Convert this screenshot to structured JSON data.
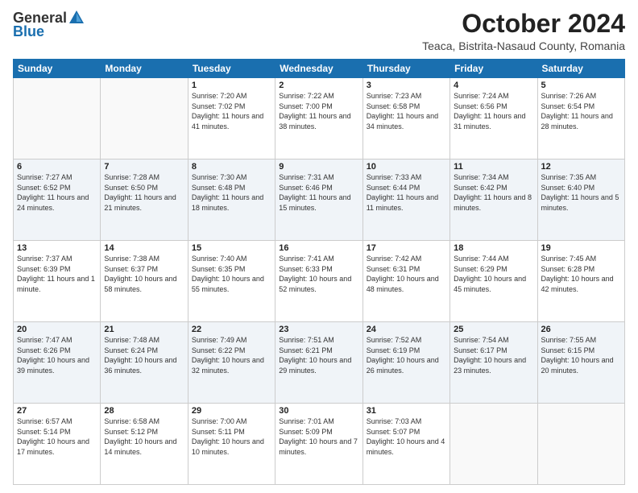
{
  "header": {
    "logo_general": "General",
    "logo_blue": "Blue",
    "month": "October 2024",
    "location": "Teaca, Bistrita-Nasaud County, Romania"
  },
  "days_of_week": [
    "Sunday",
    "Monday",
    "Tuesday",
    "Wednesday",
    "Thursday",
    "Friday",
    "Saturday"
  ],
  "weeks": [
    [
      {
        "day": "",
        "info": ""
      },
      {
        "day": "",
        "info": ""
      },
      {
        "day": "1",
        "info": "Sunrise: 7:20 AM\nSunset: 7:02 PM\nDaylight: 11 hours and 41 minutes."
      },
      {
        "day": "2",
        "info": "Sunrise: 7:22 AM\nSunset: 7:00 PM\nDaylight: 11 hours and 38 minutes."
      },
      {
        "day": "3",
        "info": "Sunrise: 7:23 AM\nSunset: 6:58 PM\nDaylight: 11 hours and 34 minutes."
      },
      {
        "day": "4",
        "info": "Sunrise: 7:24 AM\nSunset: 6:56 PM\nDaylight: 11 hours and 31 minutes."
      },
      {
        "day": "5",
        "info": "Sunrise: 7:26 AM\nSunset: 6:54 PM\nDaylight: 11 hours and 28 minutes."
      }
    ],
    [
      {
        "day": "6",
        "info": "Sunrise: 7:27 AM\nSunset: 6:52 PM\nDaylight: 11 hours and 24 minutes."
      },
      {
        "day": "7",
        "info": "Sunrise: 7:28 AM\nSunset: 6:50 PM\nDaylight: 11 hours and 21 minutes."
      },
      {
        "day": "8",
        "info": "Sunrise: 7:30 AM\nSunset: 6:48 PM\nDaylight: 11 hours and 18 minutes."
      },
      {
        "day": "9",
        "info": "Sunrise: 7:31 AM\nSunset: 6:46 PM\nDaylight: 11 hours and 15 minutes."
      },
      {
        "day": "10",
        "info": "Sunrise: 7:33 AM\nSunset: 6:44 PM\nDaylight: 11 hours and 11 minutes."
      },
      {
        "day": "11",
        "info": "Sunrise: 7:34 AM\nSunset: 6:42 PM\nDaylight: 11 hours and 8 minutes."
      },
      {
        "day": "12",
        "info": "Sunrise: 7:35 AM\nSunset: 6:40 PM\nDaylight: 11 hours and 5 minutes."
      }
    ],
    [
      {
        "day": "13",
        "info": "Sunrise: 7:37 AM\nSunset: 6:39 PM\nDaylight: 11 hours and 1 minute."
      },
      {
        "day": "14",
        "info": "Sunrise: 7:38 AM\nSunset: 6:37 PM\nDaylight: 10 hours and 58 minutes."
      },
      {
        "day": "15",
        "info": "Sunrise: 7:40 AM\nSunset: 6:35 PM\nDaylight: 10 hours and 55 minutes."
      },
      {
        "day": "16",
        "info": "Sunrise: 7:41 AM\nSunset: 6:33 PM\nDaylight: 10 hours and 52 minutes."
      },
      {
        "day": "17",
        "info": "Sunrise: 7:42 AM\nSunset: 6:31 PM\nDaylight: 10 hours and 48 minutes."
      },
      {
        "day": "18",
        "info": "Sunrise: 7:44 AM\nSunset: 6:29 PM\nDaylight: 10 hours and 45 minutes."
      },
      {
        "day": "19",
        "info": "Sunrise: 7:45 AM\nSunset: 6:28 PM\nDaylight: 10 hours and 42 minutes."
      }
    ],
    [
      {
        "day": "20",
        "info": "Sunrise: 7:47 AM\nSunset: 6:26 PM\nDaylight: 10 hours and 39 minutes."
      },
      {
        "day": "21",
        "info": "Sunrise: 7:48 AM\nSunset: 6:24 PM\nDaylight: 10 hours and 36 minutes."
      },
      {
        "day": "22",
        "info": "Sunrise: 7:49 AM\nSunset: 6:22 PM\nDaylight: 10 hours and 32 minutes."
      },
      {
        "day": "23",
        "info": "Sunrise: 7:51 AM\nSunset: 6:21 PM\nDaylight: 10 hours and 29 minutes."
      },
      {
        "day": "24",
        "info": "Sunrise: 7:52 AM\nSunset: 6:19 PM\nDaylight: 10 hours and 26 minutes."
      },
      {
        "day": "25",
        "info": "Sunrise: 7:54 AM\nSunset: 6:17 PM\nDaylight: 10 hours and 23 minutes."
      },
      {
        "day": "26",
        "info": "Sunrise: 7:55 AM\nSunset: 6:15 PM\nDaylight: 10 hours and 20 minutes."
      }
    ],
    [
      {
        "day": "27",
        "info": "Sunrise: 6:57 AM\nSunset: 5:14 PM\nDaylight: 10 hours and 17 minutes."
      },
      {
        "day": "28",
        "info": "Sunrise: 6:58 AM\nSunset: 5:12 PM\nDaylight: 10 hours and 14 minutes."
      },
      {
        "day": "29",
        "info": "Sunrise: 7:00 AM\nSunset: 5:11 PM\nDaylight: 10 hours and 10 minutes."
      },
      {
        "day": "30",
        "info": "Sunrise: 7:01 AM\nSunset: 5:09 PM\nDaylight: 10 hours and 7 minutes."
      },
      {
        "day": "31",
        "info": "Sunrise: 7:03 AM\nSunset: 5:07 PM\nDaylight: 10 hours and 4 minutes."
      },
      {
        "day": "",
        "info": ""
      },
      {
        "day": "",
        "info": ""
      }
    ]
  ]
}
